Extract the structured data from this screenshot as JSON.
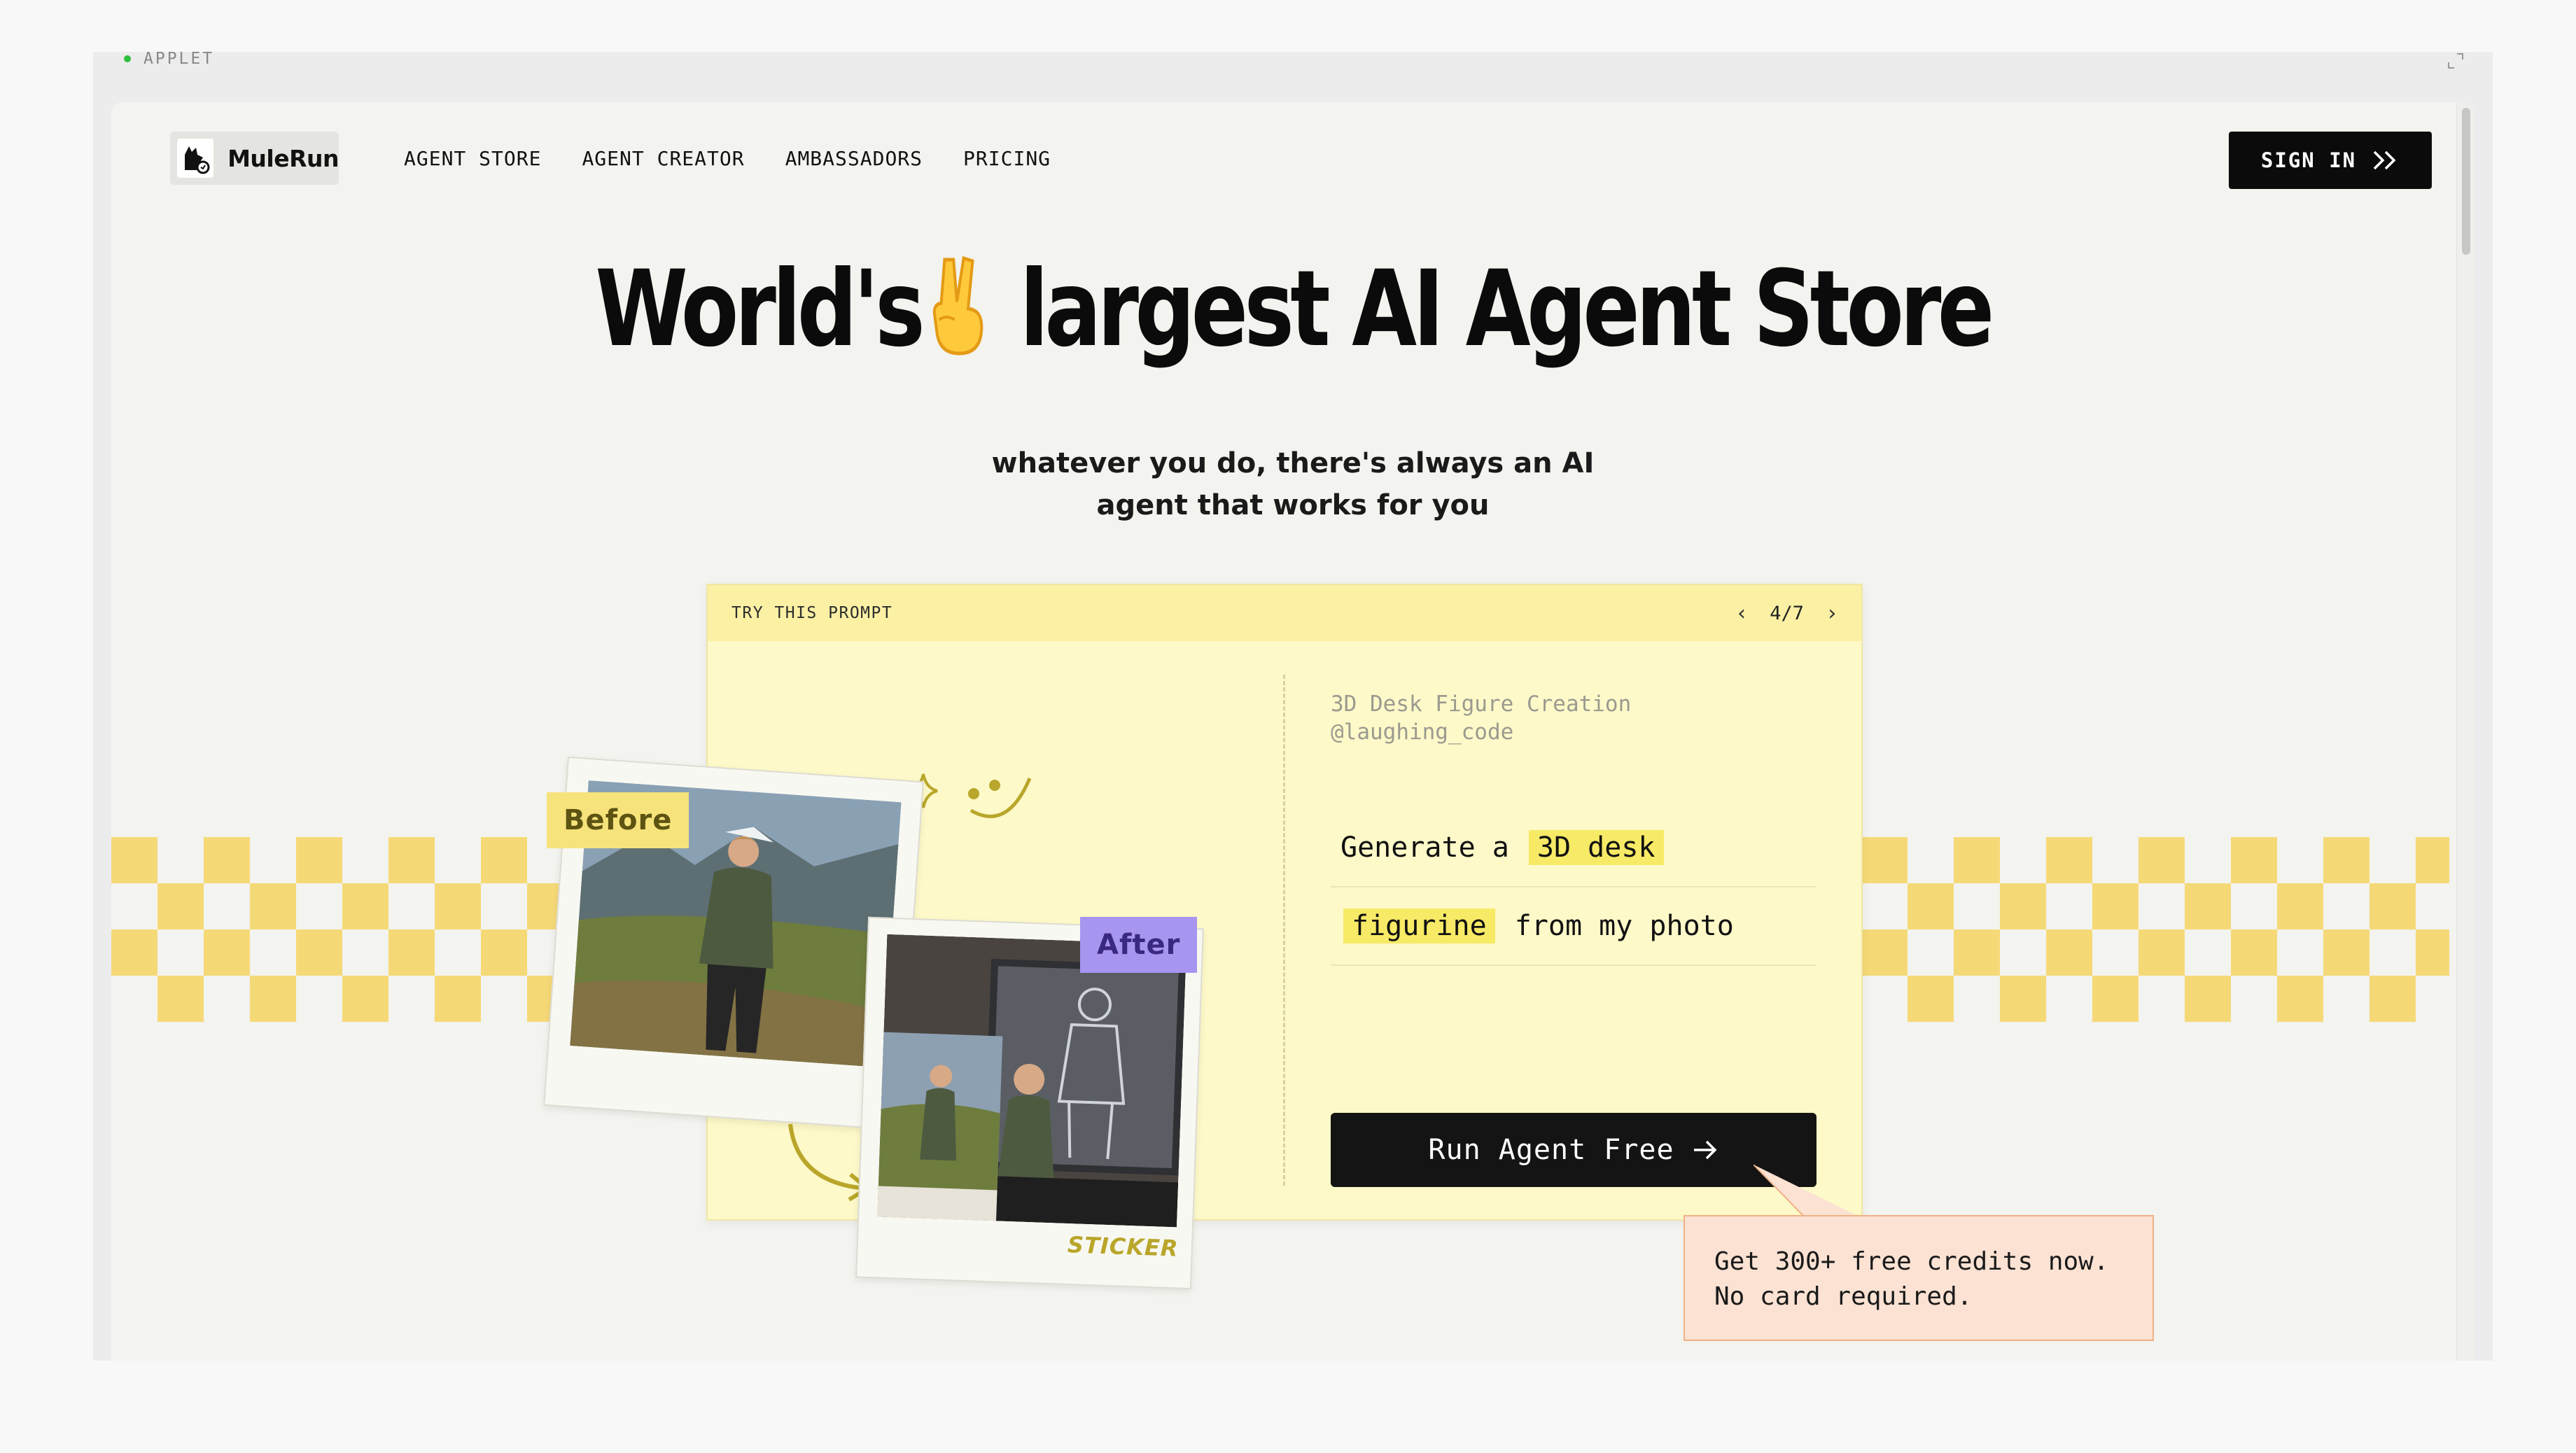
{
  "applet": {
    "label": "APPLET"
  },
  "header": {
    "logo_text": "MuleRun",
    "nav": [
      "AGENT STORE",
      "AGENT CREATOR",
      "AMBASSADORS",
      "PRICING"
    ],
    "sign_in_label": "SIGN IN"
  },
  "hero": {
    "title_part1": "World's",
    "title_part2": "largest AI Agent Store",
    "subtitle_line1": "whatever you do, there's always an AI",
    "subtitle_line2": "agent that works for you"
  },
  "prompt_card": {
    "bar_label": "TRY THIS PROMPT",
    "pager": "4/7",
    "title": "3D Desk Figure Creation",
    "author": "@laughing_code",
    "line1_plain": "Generate a",
    "line1_highlight": "3D desk",
    "line2_highlight": "figurine",
    "line2_plain": "from my photo",
    "run_button_label": "Run Agent Free"
  },
  "promo": {
    "line1": "Get 300+ free credits now.",
    "line2": "No card required."
  },
  "showcase": {
    "before_tag": "Before",
    "after_tag": "After",
    "sticker_label": "STICKER"
  },
  "colors": {
    "accent_yellow": "#f6d977",
    "card_bg": "#fdf9c8",
    "button_dark": "#141414",
    "promo_bg": "#fbe2d3",
    "promo_border": "#f0b186",
    "after_tag": "#a895f0"
  },
  "icons": [
    "mule-logo-icon",
    "double-chevron-right-icon",
    "peace-hand-emoji-icon",
    "chevron-left-icon",
    "chevron-right-icon",
    "arrow-right-icon",
    "sparkle-icon",
    "smile-doodle-icon",
    "curved-arrow-icon",
    "expand-icon"
  ]
}
